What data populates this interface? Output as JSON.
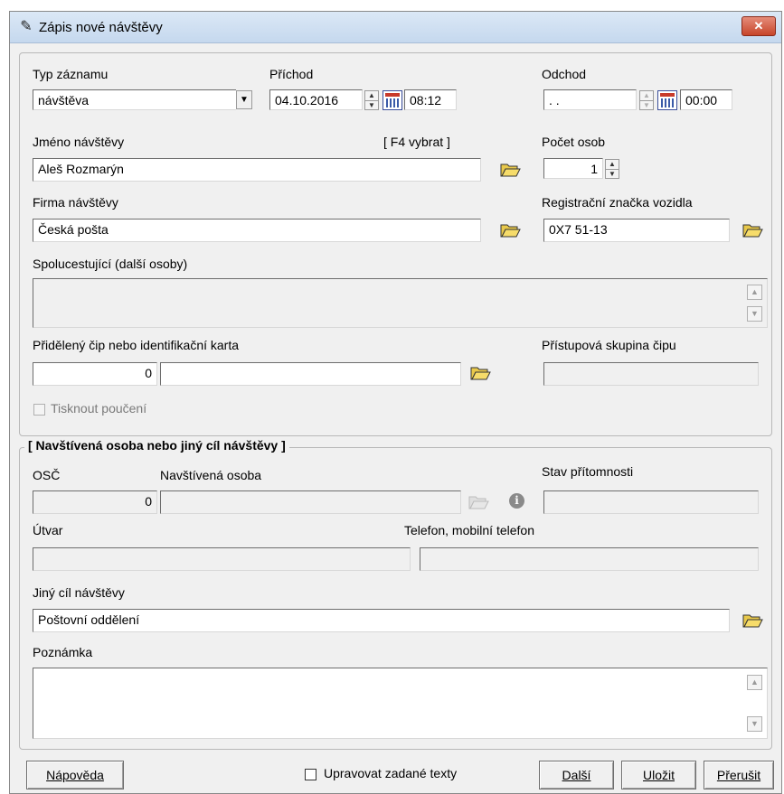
{
  "window": {
    "title": "Zápis nové návštěvy",
    "close_label": "✕"
  },
  "record": {
    "type_label": "Typ záznamu",
    "type_value": "návštěva",
    "arrival_label": "Příchod",
    "arrival_date": "04.10.2016",
    "arrival_time": "08:12",
    "departure_label": "Odchod",
    "departure_date": ". .",
    "departure_time": "00:00"
  },
  "visitor": {
    "name_label": "Jméno návštěvy",
    "name_hint": "[ F4 vybrat ]",
    "name_value": "Aleš Rozmarýn",
    "count_label": "Počet osob",
    "count_value": "1",
    "company_label": "Firma návštěvy",
    "company_value": "Česká pošta",
    "plate_label": "Registrační značka vozidla",
    "plate_value": "0X7 51-13",
    "companions_label": "Spolucestující (další osoby)",
    "chip_label": "Přidělený čip nebo identifikační karta",
    "chip_number": "0",
    "chip_text": "",
    "access_group_label": "Přístupová skupina čipu",
    "print_label": "Tisknout poučení"
  },
  "target": {
    "section_title": "[ Navštívená osoba nebo jiný cíl návštěvy ]",
    "osc_label": "OSČ",
    "osc_value": "0",
    "person_label": "Navštívená osoba",
    "presence_label": "Stav přítomnosti",
    "unit_label": "Útvar",
    "phone_label": "Telefon, mobilní telefon",
    "other_target_label": "Jiný cíl návštěvy",
    "other_target_value": "Poštovní oddělení",
    "note_label": "Poznámka"
  },
  "footer": {
    "help_label": "Nápověda",
    "edit_texts_label": "Upravovat zadané texty",
    "next_label": "Další",
    "save_label": "Uložit",
    "cancel_label": "Přerušit"
  },
  "colors": {
    "title_bar": "#c5d8ee",
    "window_bg": "#f0f0f0",
    "close_button": "#c7452a"
  },
  "icons": [
    "pen-icon",
    "calendar-icon",
    "folder-open-icon",
    "info-icon",
    "chevron-down-icon",
    "spin-up-icon",
    "spin-down-icon"
  ]
}
